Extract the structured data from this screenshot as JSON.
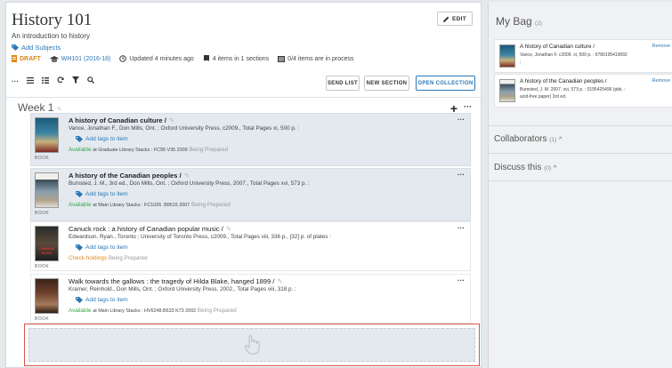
{
  "course": {
    "title": "History 101",
    "subtitle": "An introduction to history",
    "add_subjects": "Add Subjects",
    "status": "DRAFT",
    "code": "WH101 (2016-18)",
    "updated": "Updated 4 minutes ago",
    "items_count": "4 items in 1 sections",
    "in_process": "0/4 items are in process",
    "edit_label": "EDIT"
  },
  "toolbar": {
    "send_list": "SEND LIST",
    "new_section": "NEW SECTION",
    "open_collection": "OPEN COLLECTION"
  },
  "section": {
    "title": "Week 1"
  },
  "items": [
    {
      "title": "A history of Canadian culture /",
      "meta": "Vance, Jonathan F., Don Mills, Ont. ; Oxford University Press, c2009., Total Pages xi, 500 p. :",
      "tags": "Add tags to item",
      "avail": "Available",
      "location": "at Graduate Library Stacks : FC95 V35 2009",
      "prep": "Being Prepared",
      "type": "BOOK"
    },
    {
      "title": "A history of the Canadian peoples /",
      "meta": "Bumsted, J. M., 3rd ed., Don Mills, Ont. ; Oxford University Press, 2007., Total Pages xvi, 573 p. :",
      "tags": "Add tags to item",
      "avail": "Available",
      "location": "at Main Library Stacks : FC1026 .B9515 2007",
      "prep": "Being Prepared",
      "type": "BOOK"
    },
    {
      "title": "Canuck rock : a history of Canadian popular music /",
      "meta": "Edwardson, Ryan., Toronto ; University of Toronto Press, c2009., Total Pages viii, 336 p., [32] p. of plates :",
      "tags": "Add tags to item",
      "avail": "Check holdings",
      "location": "",
      "prep": "Being Prepared",
      "type": "BOOK",
      "thumb_text": "CANUCK ROCK"
    },
    {
      "title": "Walk towards the gallows : the tragedy of Hilda Blake, hanged 1899 /",
      "meta": "Kramer, Reinhold., Don Mills, Ont. ; Oxford University Press, 2002., Total Pages viii, 318 p. :",
      "tags": "Add tags to item",
      "avail": "Available",
      "location": "at Main Library Stacks : HV6248.B633 K73 2002",
      "prep": "Being Prepared",
      "type": "BOOK"
    }
  ],
  "bag": {
    "title": "My Bag",
    "count": "(2)",
    "items": [
      {
        "title": "A history of Canadian culture /",
        "meta": "Vance, Jonathan F. c2009. xi, 500 p. : 9780195419092",
        "meta2": ";",
        "remove": "Remove"
      },
      {
        "title": "A history of the Canadian peoples /",
        "meta": "Bumsted, J. M. 2007. xvi, 573 p. : 0195425496 (pbk. :",
        "meta2": "acid-free paper) 3rd ed.",
        "remove": "Remove"
      }
    ]
  },
  "collaborators": {
    "title": "Collaborators",
    "count": "(1)"
  },
  "discuss": {
    "title": "Discuss this",
    "count": "(0)"
  },
  "colors": {
    "accent": "#2a77b5",
    "draft": "#d9861c",
    "available": "#3aa34a",
    "check": "#e0891e",
    "drop_border": "#d9534f"
  }
}
